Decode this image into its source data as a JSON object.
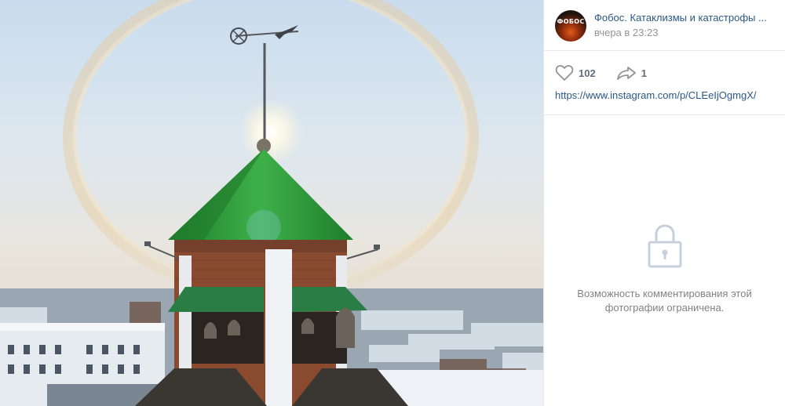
{
  "post": {
    "author": "Фобос. Катаклизмы и катастрофы ...",
    "avatar_text": "ФОБОС",
    "date": "вчера в 23:23",
    "likes": "102",
    "shares": "1",
    "link": "https://www.instagram.com/p/CLEeIjOgmgX/"
  },
  "comments": {
    "restricted_message": "Возможность комментирования этой фотографии ограничена."
  },
  "icons": {
    "like": "heart-icon",
    "share": "share-arrow-icon",
    "lock": "lock-icon"
  },
  "colors": {
    "link": "#2a5885",
    "muted": "#939393",
    "roof": "#2f9a3a"
  }
}
